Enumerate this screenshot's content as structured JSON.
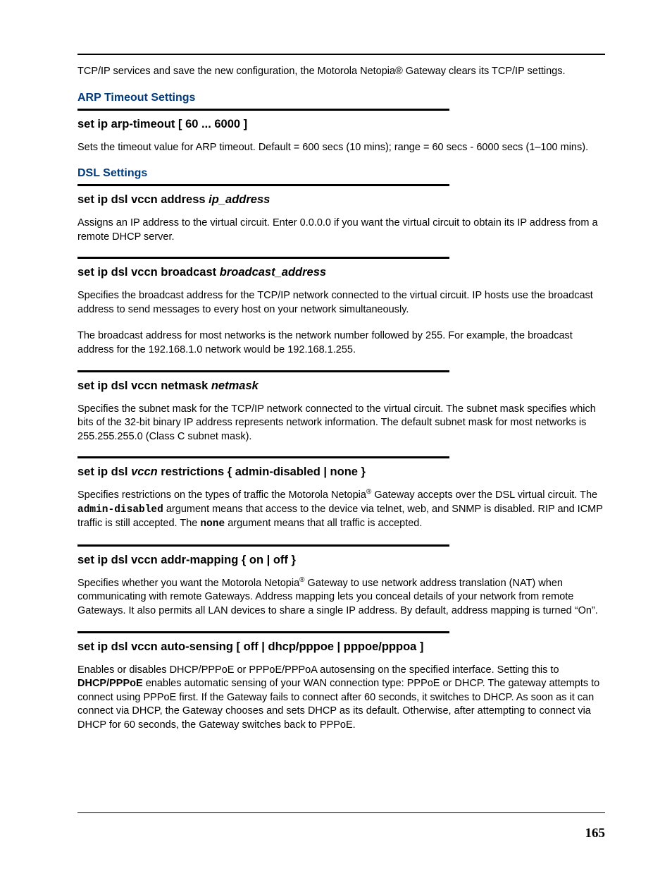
{
  "intro": "TCP/IP services and save the new configuration, the Motorola Netopia® Gateway clears its TCP/IP settings.",
  "section1": {
    "title": "ARP Timeout Settings",
    "cmd": "set ip arp-timeout [ 60 ... 6000 ]",
    "desc": "Sets the timeout value for ARP timeout. Default = 600 secs (10 mins); range = 60 secs - 6000 secs (1–100 mins)."
  },
  "section2": {
    "title": "DSL Settings",
    "items": [
      {
        "cmd_pre": "set ip dsl vccn address ",
        "cmd_ital": "ip_address",
        "paras": [
          "Assigns an IP address to the virtual circuit. Enter 0.0.0.0 if you want the virtual circuit to obtain its IP address from a remote DHCP server."
        ]
      },
      {
        "cmd_pre": "set ip dsl vccn broadcast ",
        "cmd_ital": "broadcast_address",
        "paras": [
          "Specifies the broadcast address for the TCP/IP network connected to the virtual circuit. IP hosts use the broadcast address to send messages to every host on your network simultaneously.",
          "The broadcast address for most networks is the network number followed by 255. For example, the broadcast address for the 192.168.1.0 network would be 192.168.1.255."
        ]
      },
      {
        "cmd_pre": "set ip dsl vccn netmask ",
        "cmd_ital": "netmask",
        "paras": [
          "Specifies the subnet mask for the TCP/IP network connected to the virtual circuit. The subnet mask specifies which bits of the 32-bit binary IP address represents network information. The default subnet mask for most networks is 255.255.255.0 (Class C subnet mask)."
        ]
      }
    ],
    "restrictions": {
      "cmd_p1": "set ip dsl ",
      "cmd_vccn": "vccn",
      "cmd_p2": " restrictions { admin-disabled | none }",
      "desc_p1": "Specifies restrictions on the types of traffic the Motorola Netopia",
      "desc_p2": " Gateway accepts over the DSL virtual circuit. The ",
      "mono1": "admin-disabled",
      "desc_p3": " argument means that access to the device via telnet, web, and SNMP is disabled. RIP and ICMP traffic is still accepted. The ",
      "mono2": "none",
      "desc_p4": " argument means that all traffic is accepted."
    },
    "addrmap": {
      "cmd": "set ip dsl vccn addr-mapping { on | off }",
      "desc_p1": "Specifies whether you want the Motorola Netopia",
      "desc_p2": " Gateway to use network address translation (NAT) when communicating with remote Gateways. Address mapping lets you conceal details of your network from remote Gateways. It also permits all LAN devices to share a single IP address. By default, address mapping is turned “On”."
    },
    "autosense": {
      "cmd": "set ip dsl vccn auto-sensing [ off | dhcp/pppoe | pppoe/pppoa ]",
      "desc_p1": "Enables or disables DHCP/PPPoE or PPPoE/PPPoA autosensing on the specified interface. Setting this to ",
      "bold": "DHCP/PPPoE",
      "desc_p2": " enables automatic sensing of your WAN connection type: PPPoE or DHCP. The gateway attempts to connect using PPPoE first. If the Gateway fails to connect after 60 seconds, it switches to DHCP. As soon as it can connect via DHCP, the Gateway chooses and sets DHCP as its default. Otherwise, after attempting to connect via DHCP for 60 seconds, the Gateway switches back to PPPoE."
    }
  },
  "page_number": "165"
}
